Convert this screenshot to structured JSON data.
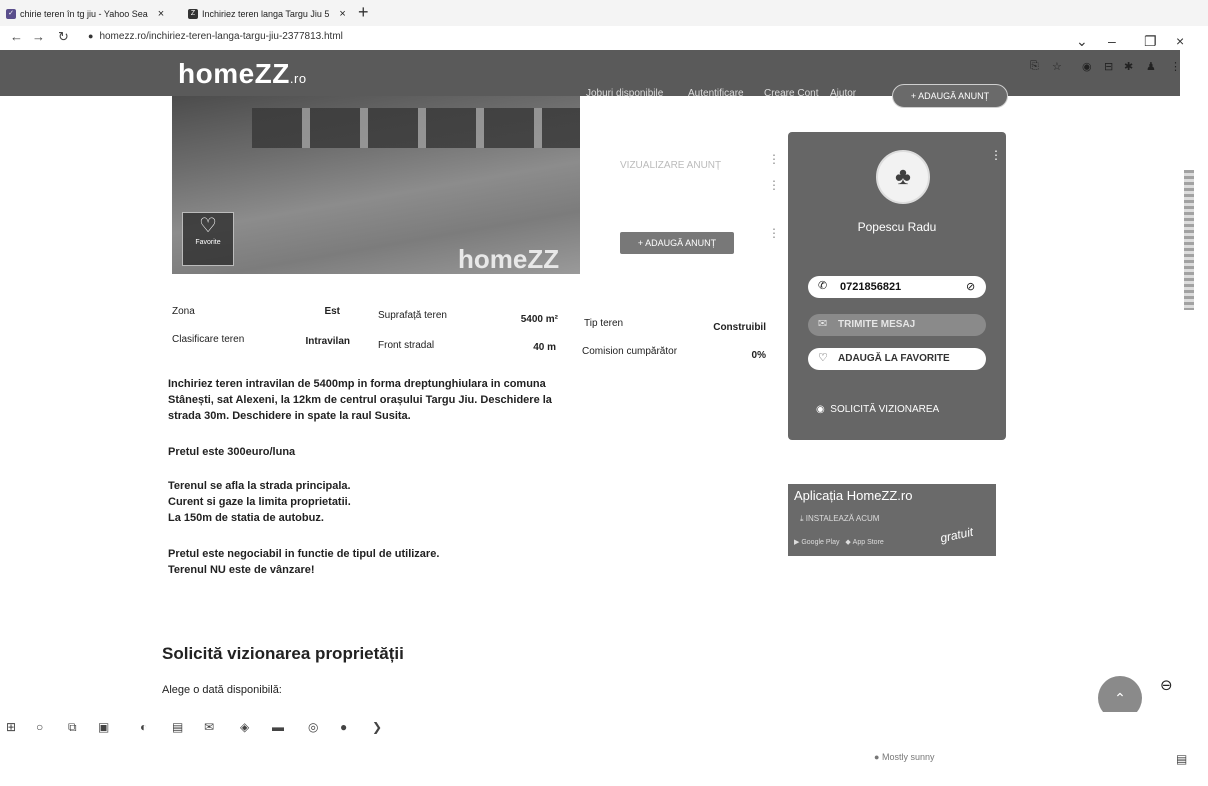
{
  "browser": {
    "tabs": [
      {
        "title": "chirie teren în tg jiu - Yahoo Sea"
      },
      {
        "title": "Inchiriez teren langa Targu Jiu 5"
      }
    ],
    "url": "homezz.ro/inchiriez-teren-langa-targu-jiu-2377813.html"
  },
  "header": {
    "logo": "homeZZ",
    "logo_suffix": ".ro",
    "nav": [
      "Joburi disponibile",
      "Autentificare",
      "Creare Cont",
      "Ajutor"
    ],
    "cta": "+ ADAUGĂ ANUNȚ"
  },
  "photo": {
    "favorite_label": "Favorite",
    "watermark": "homeZZ"
  },
  "middle_card": {
    "faded_text": "VIZUALIZARE ANUNȚ",
    "add_button": "+ ADAUGĂ ANUNȚ"
  },
  "details": {
    "rows": [
      [
        {
          "k": "Zona",
          "v": "Est"
        },
        {
          "k": "Suprafață teren",
          "v": "5400 m²"
        },
        {
          "k": "Tip teren",
          "v": "Construibil"
        }
      ],
      [
        {
          "k": "Clasificare teren",
          "v": "Intravilan"
        },
        {
          "k": "Front stradal",
          "v": "40 m"
        },
        {
          "k": "Comision cumpărător",
          "v": "0%"
        }
      ]
    ]
  },
  "description": {
    "p1": [
      "Inchiriez teren intravilan de 5400mp in forma dreptunghiulara in comuna",
      "Stânești, sat Alexeni, la 12km de centrul orașului Targu Jiu. Deschidere la",
      "strada 30m. Deschidere in spate la raul Susita."
    ],
    "p2": "Pretul este 300euro/luna",
    "p3": [
      "Terenul se afla la strada principala.",
      "Curent si gaze la limita proprietatii.",
      "La 150m de statia de autobuz."
    ],
    "p4": [
      "Pretul este negociabil in functie de tipul de utilizare.",
      "Terenul NU este de vânzare!"
    ]
  },
  "viewing": {
    "title": "Solicită vizionarea proprietății",
    "subtitle": "Alege o dată disponibilă:"
  },
  "seller": {
    "name": "Popescu Radu",
    "phone": "0721856821",
    "message_button": "TRIMITE MESAJ",
    "favorite_button": "ADAUGĂ LA FAVORITE",
    "viewing_button": "SOLICITĂ VIZIONAREA"
  },
  "app_promo": {
    "title": "Aplicația HomeZZ.ro",
    "install": "INSTALEAZĂ ACUM",
    "google": "Google Play",
    "apple": "App Store",
    "badge": "gratuit"
  },
  "taskbar": {
    "weather": "Mostly sunny"
  }
}
